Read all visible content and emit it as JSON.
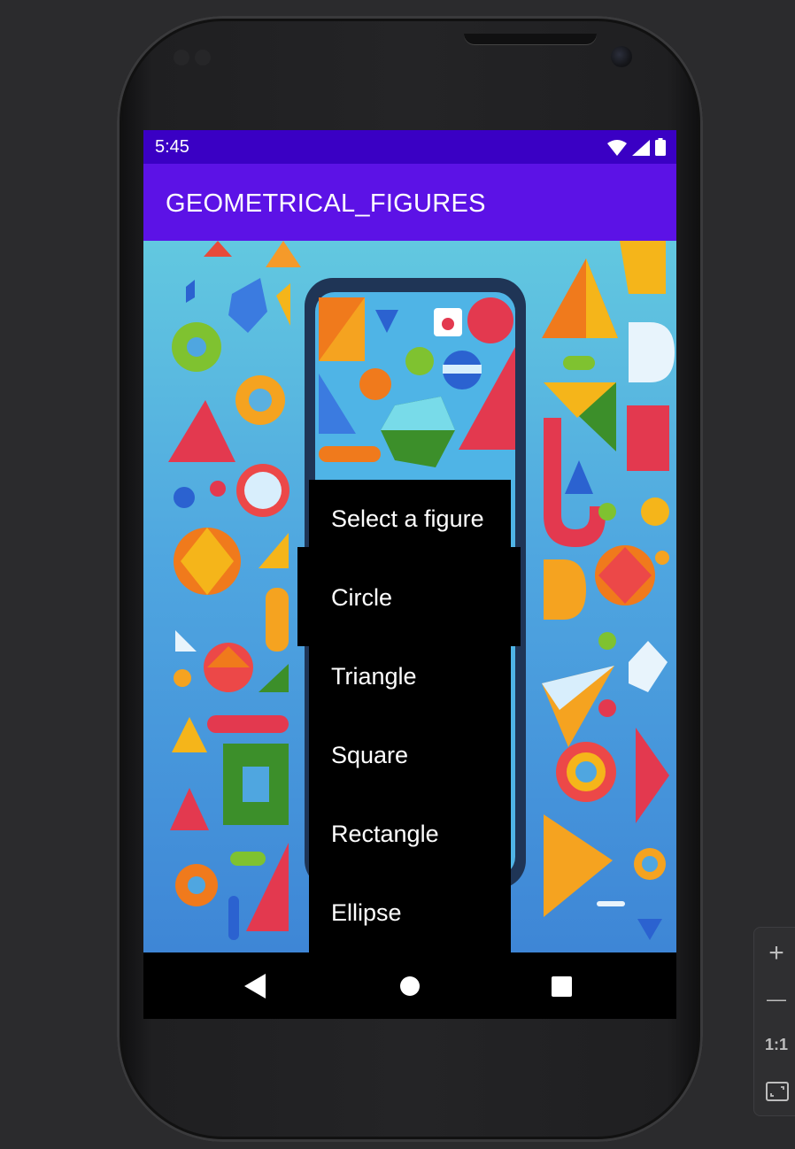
{
  "status_bar": {
    "time": "5:45"
  },
  "app_bar": {
    "title": "GEOMETRICAL_FIGURES"
  },
  "dropdown": {
    "options": [
      "Select a figure",
      "Circle",
      "Triangle",
      "Square",
      "Rectangle",
      "Ellipse"
    ]
  },
  "zoom_controls": {
    "zoom_in": "+",
    "zoom_out": "—",
    "actual_size": "1:1"
  },
  "colors": {
    "status_bar": "#3a00c4",
    "app_bar": "#5c12e6",
    "menu_background": "#000000",
    "menu_text": "#ffffff"
  }
}
